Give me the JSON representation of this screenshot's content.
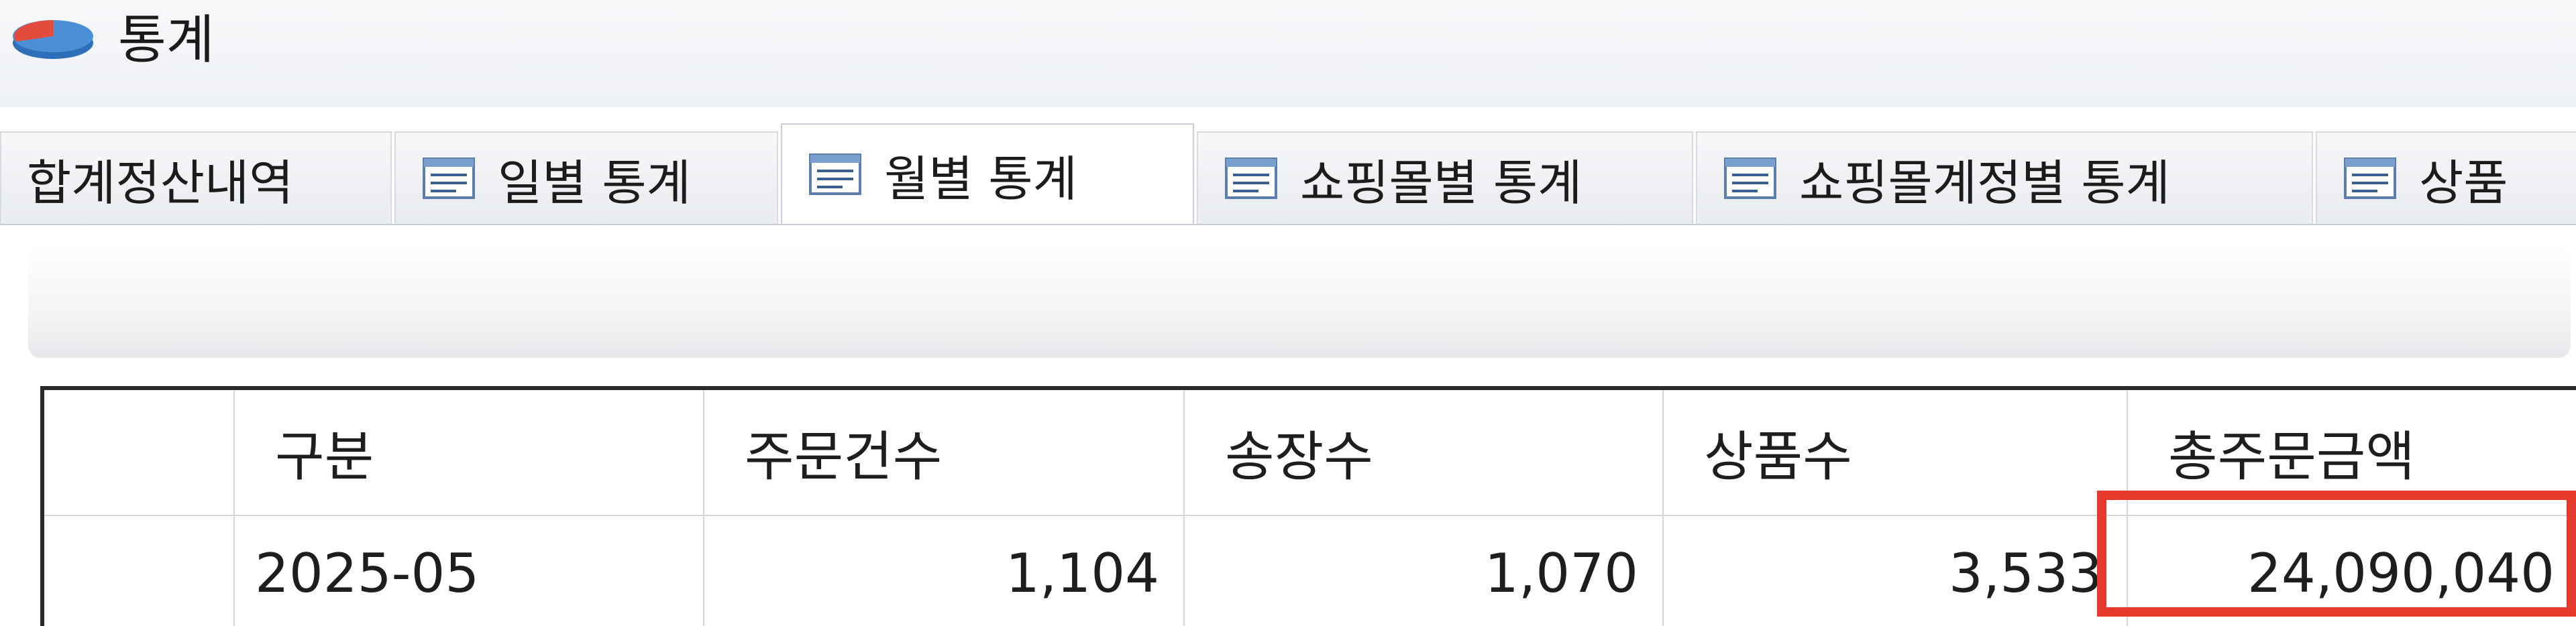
{
  "window": {
    "title": "통계",
    "icon": "pie-chart-icon"
  },
  "tabs": [
    {
      "label": "합계정산내역",
      "icon": "",
      "active": false
    },
    {
      "label": "일별 통계",
      "icon": "grid-table-icon",
      "active": false
    },
    {
      "label": "월별 통계",
      "icon": "grid-table-icon",
      "active": true
    },
    {
      "label": "쇼핑몰별 통계",
      "icon": "grid-table-icon",
      "active": false
    },
    {
      "label": "쇼핑몰계정별 통계",
      "icon": "grid-table-icon",
      "active": false
    },
    {
      "label": "상품",
      "icon": "grid-table-icon",
      "active": false
    }
  ],
  "table": {
    "columns": [
      "구분",
      "주문건수",
      "송장수",
      "상품수",
      "총주문금액"
    ],
    "rows": [
      {
        "period": "2025-05",
        "orders": "1,104",
        "invoices": "1,070",
        "products": "3,533",
        "total_amount": "24,090,040"
      }
    ]
  },
  "colors": {
    "highlight": "#e53a2c",
    "grid_border": "#2a2a2a",
    "icon_blue": "#2f6fb9",
    "icon_red": "#e34b3d"
  }
}
